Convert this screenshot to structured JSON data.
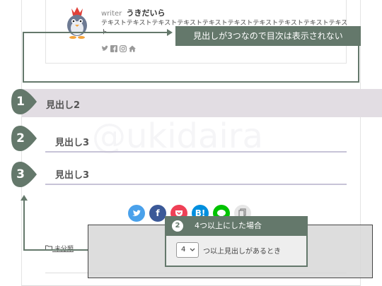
{
  "author": {
    "writer_label": "writer",
    "writer_name": "うきだいら",
    "description": "テキストテキストテキストテキストテキストテキストテキストテキストテキストテキスト",
    "sns": [
      "twitter-icon",
      "facebook-icon",
      "instagram-icon",
      "home-icon"
    ]
  },
  "callout1": {
    "text": "見出しが3つなので目次は表示されない"
  },
  "headings": {
    "h2": "見出し2",
    "h3_first": "見出し3",
    "h3_second": "見出し3"
  },
  "badges": {
    "one": "1",
    "two": "2",
    "three": "3"
  },
  "share": {
    "twitter": "",
    "facebook": "f",
    "pocket": "",
    "hatena": "B!",
    "line": "",
    "copy": ""
  },
  "category": {
    "label": "未分類"
  },
  "callout2": {
    "number": "2",
    "title": "4つ以上にした場合",
    "select_value": "4",
    "option_label": "つ以上見出しがあるとき"
  },
  "watermark": "@ukidaira",
  "colors": {
    "callout": "#64786b",
    "h2_band": "#e2dde3",
    "h3_border": "#c7c3d7"
  }
}
